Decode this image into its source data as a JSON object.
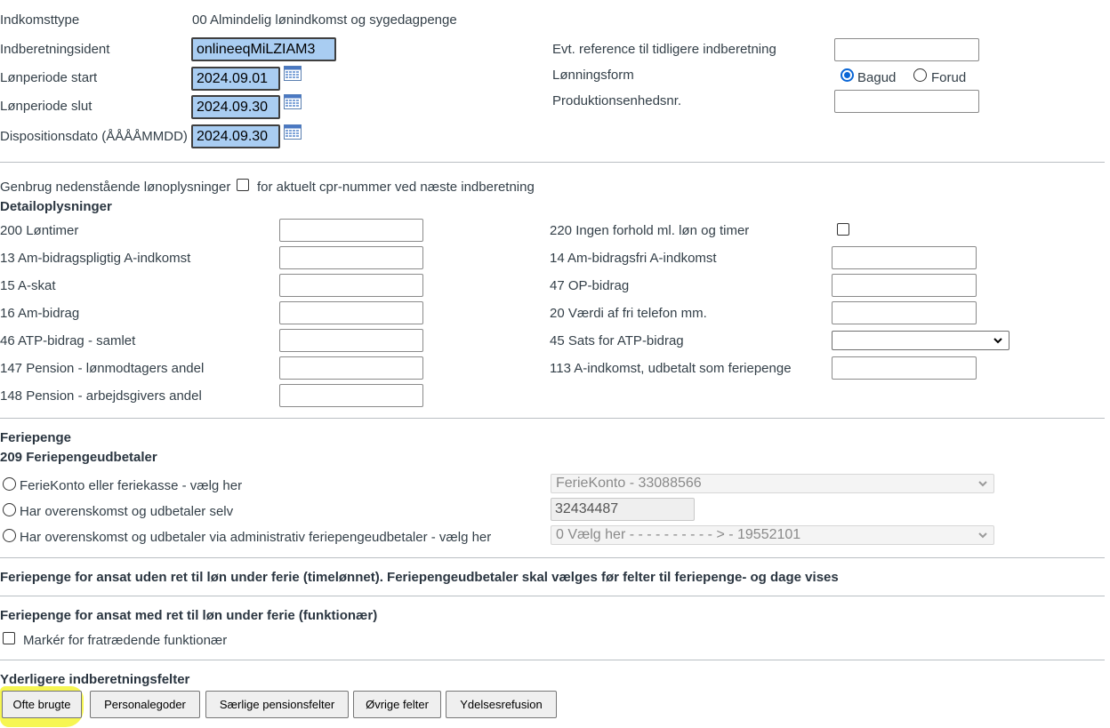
{
  "top": {
    "indkomsttype_label": "Indkomsttype",
    "indkomsttype_value": "00 Almindelig lønindkomst og sygedagpenge",
    "indberetningsident_label": "Indberetningsident",
    "indberetningsident_value": "onlineeqMiLZIAM3",
    "lonperiode_start_label": "Lønperiode start",
    "lonperiode_start_value": "2024.09.01",
    "lonperiode_slut_label": "Lønperiode slut",
    "lonperiode_slut_value": "2024.09.30",
    "dispositionsdato_label": "Dispositionsdato (ÅÅÅÅMMDD)",
    "dispositionsdato_value": "2024.09.30",
    "evt_reference_label": "Evt. reference til tidligere indberetning",
    "evt_reference_value": "",
    "lonningsform_label": "Lønningsform",
    "bagud_label": "Bagud",
    "forud_label": "Forud",
    "produktionsenhed_label": "Produktionsenhedsnr.",
    "produktionsenhed_value": ""
  },
  "genbrug": {
    "prefix": "Genbrug nedenstående lønoplysninger",
    "suffix": "for aktuelt cpr-nummer ved næste indberetning"
  },
  "detail": {
    "heading": "Detailoplysninger",
    "left": [
      {
        "label": "200 Løntimer",
        "value": ""
      },
      {
        "label": "13 Am-bidragspligtig A-indkomst",
        "value": ""
      },
      {
        "label": "15 A-skat",
        "value": ""
      },
      {
        "label": "16 Am-bidrag",
        "value": ""
      },
      {
        "label": "46 ATP-bidrag - samlet",
        "value": ""
      },
      {
        "label": "147 Pension - lønmodtagers andel",
        "value": ""
      },
      {
        "label": "148 Pension - arbejdsgivers andel",
        "value": ""
      }
    ],
    "right": [
      {
        "label": "220 Ingen forhold ml. løn og timer"
      },
      {
        "label": "14 Am-bidragsfri A-indkomst",
        "value": ""
      },
      {
        "label": "47 OP-bidrag",
        "value": ""
      },
      {
        "label": "20 Værdi af fri telefon mm.",
        "value": ""
      },
      {
        "label": "45 Sats for ATP-bidrag",
        "value": ""
      },
      {
        "label": "113 A-indkomst, udbetalt som feriepenge",
        "value": ""
      }
    ]
  },
  "feriepenge": {
    "heading": "Feriepenge",
    "subheading": "209 Feriepengeudbetaler",
    "opt1_label": "FerieKonto eller feriekasse - vælg her",
    "opt1_select": "FerieKonto - 33088566",
    "opt2_label": "Har overenskomst og udbetaler selv",
    "opt2_value": "32434487",
    "opt3_label": "Har overenskomst og udbetaler via administrativ feriepengeudbetaler - vælg her",
    "opt3_select": "0 Vælg her - - - - - - - - - - > - 19552101"
  },
  "timelonnet_heading": "Feriepenge for ansat uden ret til løn under ferie (timelønnet). Feriepengeudbetaler skal vælges før felter til feriepenge- og dage vises",
  "funktionaer": {
    "heading": "Feriepenge for ansat med ret til løn under ferie (funktionær)",
    "checkbox_label": "Markér for fratrædende funktionær"
  },
  "yderligere": {
    "heading": "Yderligere indberetningsfelter",
    "buttons": [
      "Ofte brugte",
      "Personalegoder",
      "Særlige pensionsfelter",
      "Øvrige felter",
      "Ydelsesrefusion"
    ]
  },
  "colors": {
    "text": "#333f48",
    "highlight": "#f6f64a",
    "input_highlight": "#a9cdf2",
    "radio_accent": "#0a66d6"
  }
}
